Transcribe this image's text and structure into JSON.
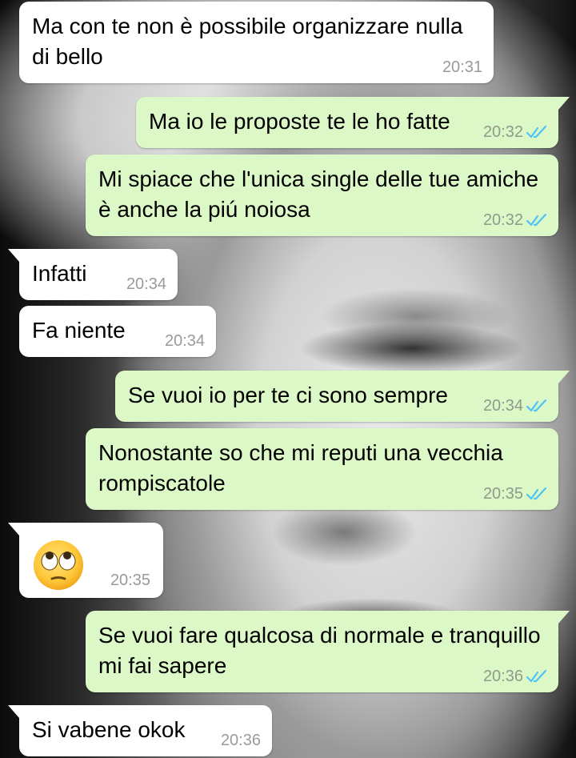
{
  "messages": [
    {
      "direction": "in",
      "text": "Ma con te non è possibile organizzare nulla di bello",
      "time": "20:31"
    },
    {
      "direction": "out",
      "text": "Ma io le proposte te le ho fatte",
      "time": "20:32",
      "status": "read"
    },
    {
      "direction": "out",
      "text": "Mi spiace che l'unica single delle tue amiche è anche la piú noiosa",
      "time": "20:32",
      "status": "read"
    },
    {
      "direction": "in",
      "text": "Infatti",
      "time": "20:34"
    },
    {
      "direction": "in",
      "text": "Fa niente",
      "time": "20:34"
    },
    {
      "direction": "out",
      "text": "Se vuoi io per te ci sono sempre",
      "time": "20:34",
      "status": "read"
    },
    {
      "direction": "out",
      "text": "Nonostante so che mi reputi una vecchia rompiscatole",
      "time": "20:35",
      "status": "read"
    },
    {
      "direction": "in",
      "emoji": "face-with-rolling-eyes",
      "time": "20:35"
    },
    {
      "direction": "out",
      "text": "Se vuoi fare qualcosa di normale e tranquillo mi fai sapere",
      "time": "20:36",
      "status": "read"
    },
    {
      "direction": "in",
      "text": "Si vabene okok",
      "time": "20:36"
    }
  ],
  "colors": {
    "incoming_bubble": "#ffffff",
    "outgoing_bubble": "#dcf8c6",
    "read_ticks": "#4fc3f7",
    "timestamp": "#9a9a9a"
  }
}
